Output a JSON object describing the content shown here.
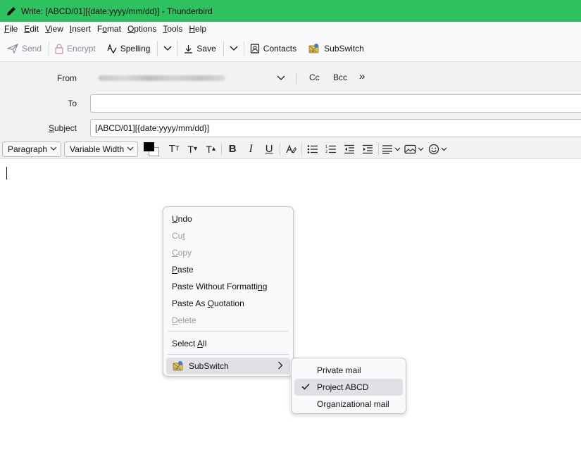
{
  "window": {
    "title": "Write: [ABCD/01][{date:yyyy/mm/dd}] - Thunderbird"
  },
  "menubar": {
    "items": [
      {
        "label": "File",
        "ul": "F",
        "rest": "ile"
      },
      {
        "label": "Edit",
        "ul": "E",
        "rest": "dit"
      },
      {
        "label": "View",
        "ul": "V",
        "rest": "iew"
      },
      {
        "label": "Insert",
        "ul": "I",
        "rest": "nsert"
      },
      {
        "label": "Format",
        "ul": "F",
        "rest": "ormat",
        "pre": ""
      },
      {
        "label": "Options",
        "ul": "O",
        "rest": "ptions"
      },
      {
        "label": "Tools",
        "ul": "T",
        "rest": "ools"
      },
      {
        "label": "Help",
        "ul": "H",
        "rest": "elp"
      }
    ]
  },
  "toolbar": {
    "send": "Send",
    "encrypt": "Encrypt",
    "spelling": "Spelling",
    "save": "Save",
    "contacts": "Contacts",
    "subswitch": "SubSwitch"
  },
  "headers": {
    "from_label": "From",
    "cc": "Cc",
    "bcc": "Bcc",
    "more": "»",
    "to_label": "To",
    "to_value": "",
    "subject_label": "Subject",
    "subject_value": "[ABCD/01][{date:yyyy/mm/dd}]"
  },
  "format": {
    "paragraph": "Paragraph",
    "font": "Variable Width",
    "text_color": "#000000",
    "bg_color": "#ffffff"
  },
  "context_menu": {
    "undo": {
      "pre": "",
      "ul": "U",
      "rest": "ndo"
    },
    "cut": {
      "pre": "Cu",
      "ul": "t",
      "rest": ""
    },
    "copy": {
      "pre": "",
      "ul": "C",
      "rest": "opy"
    },
    "paste": {
      "pre": "",
      "ul": "P",
      "rest": "aste"
    },
    "paste_wo": {
      "pre": "Paste Without Formatti",
      "ul": "n",
      "rest": "g"
    },
    "paste_quote": {
      "pre": "Paste As ",
      "ul": "Q",
      "rest": "uotation"
    },
    "delete": {
      "pre": "",
      "ul": "D",
      "rest": "elete"
    },
    "select_all": {
      "pre": "Select ",
      "ul": "A",
      "rest": "ll"
    },
    "subswitch": "SubSwitch"
  },
  "submenu": {
    "items": [
      "Private mail",
      "Project ABCD",
      "Organizational mail"
    ],
    "checked_index": 1
  }
}
